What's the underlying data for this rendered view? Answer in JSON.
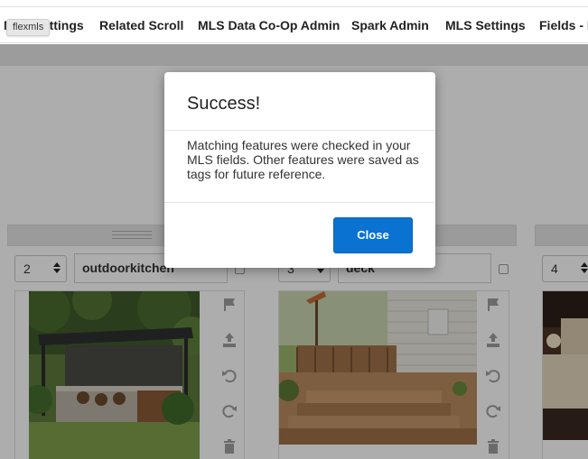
{
  "tooltip": "flexmls",
  "nav": {
    "items": [
      "MLS Settings",
      "Related Scroll",
      "MLS Data Co-Op Admin",
      "Spark Admin",
      "MLS Settings",
      "Fields - D"
    ]
  },
  "cards": [
    {
      "order": "2",
      "tag": "outdoorkitchen"
    },
    {
      "order": "3",
      "tag": "deck"
    },
    {
      "order": "4",
      "tag": ""
    }
  ],
  "modal": {
    "title": "Success!",
    "body": "Matching features were checked in your MLS fields. Other features were saved as tags for future reference.",
    "close_label": "Close"
  },
  "colors": {
    "primary_button": "#0a73d2",
    "overlay": "rgba(0,0,0,0.32)"
  },
  "icons": [
    "flag-icon",
    "upload-icon",
    "rotate-left-icon",
    "rotate-right-icon",
    "trash-icon",
    "checkbox-icon",
    "stepper-arrows-icon"
  ]
}
